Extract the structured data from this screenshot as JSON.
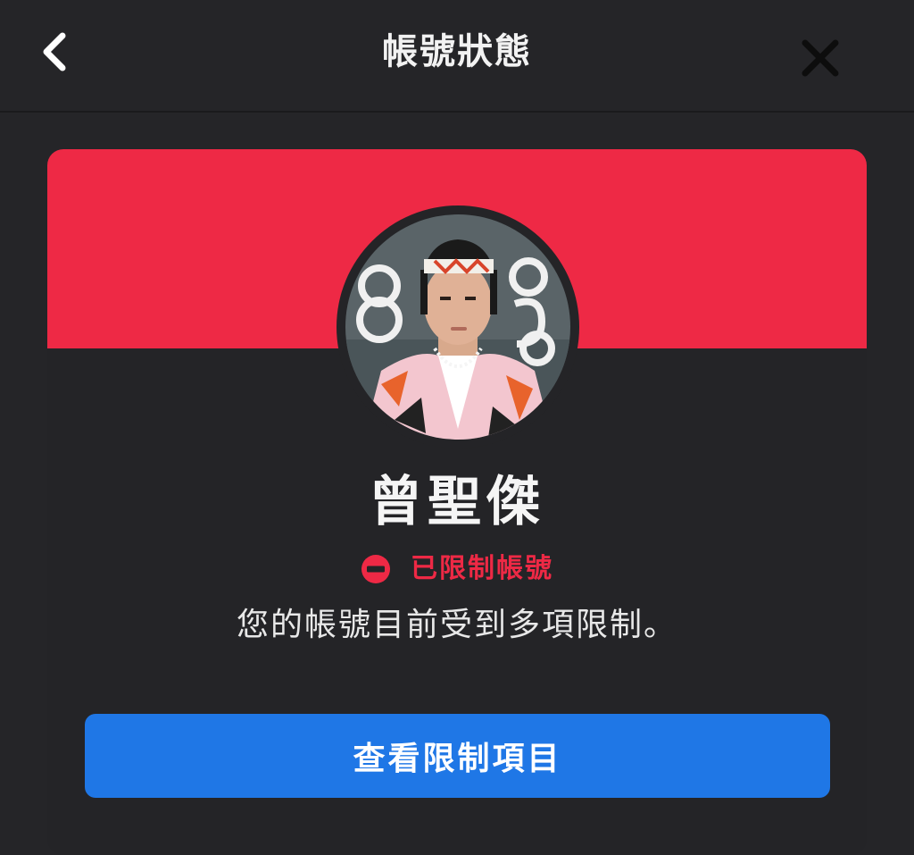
{
  "header": {
    "title": "帳號狀態",
    "back_icon": "chevron-left-icon",
    "close_icon": "close-icon"
  },
  "profile": {
    "name": "曾聖傑",
    "status_icon": "restricted-icon",
    "status_label": "已限制帳號",
    "status_description": "您的帳號目前受到多項限制。"
  },
  "actions": {
    "view_restrictions_label": "查看限制項目"
  },
  "colors": {
    "background": "#252528",
    "banner": "#ee2945",
    "status_red": "#ee2945",
    "button_blue": "#1f77e6",
    "text": "#f5f5f5"
  }
}
